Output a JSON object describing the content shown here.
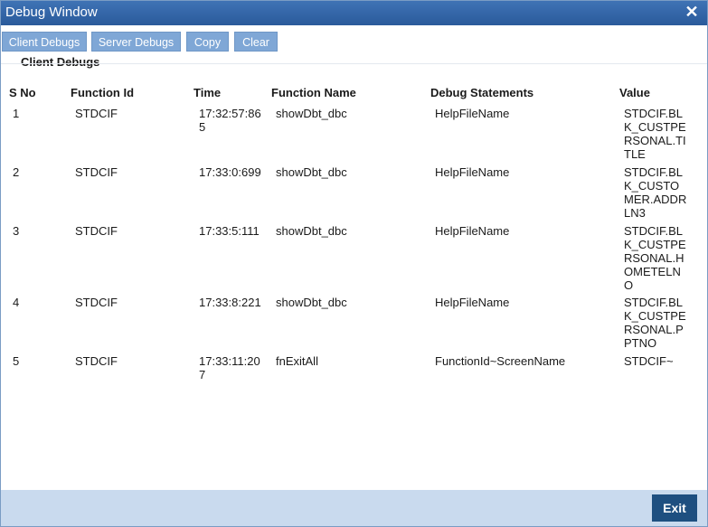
{
  "window": {
    "title": "Debug Window",
    "close_icon": "close-icon"
  },
  "toolbar": {
    "buttons": [
      {
        "label": "Client Debugs"
      },
      {
        "label": "Server Debugs"
      },
      {
        "label": "Copy"
      },
      {
        "label": "Clear"
      }
    ]
  },
  "section": {
    "title": "Client Debugs"
  },
  "table": {
    "headers": [
      "S No",
      "Function Id",
      "Time",
      "Function Name",
      "Debug Statements",
      "Value"
    ],
    "rows": [
      {
        "sno": "1",
        "function_id": "STDCIF",
        "time": "17:32:57:865",
        "function_name": "showDbt_dbc",
        "debug": "HelpFileName",
        "value": "STDCIF.BLK_CUSTPERSONAL.TITLE"
      },
      {
        "sno": "2",
        "function_id": "STDCIF",
        "time": "17:33:0:699",
        "function_name": "showDbt_dbc",
        "debug": "HelpFileName",
        "value": "STDCIF.BLK_CUSTOMER.ADDRLN3"
      },
      {
        "sno": "3",
        "function_id": "STDCIF",
        "time": "17:33:5:111",
        "function_name": "showDbt_dbc",
        "debug": "HelpFileName",
        "value": "STDCIF.BLK_CUSTPERSONAL.HOMETELNO"
      },
      {
        "sno": "4",
        "function_id": "STDCIF",
        "time": "17:33:8:221",
        "function_name": "showDbt_dbc",
        "debug": "HelpFileName",
        "value": "STDCIF.BLK_CUSTPERSONAL.PPTNO"
      },
      {
        "sno": "5",
        "function_id": "STDCIF",
        "time": "17:33:11:207",
        "function_name": "fnExitAll",
        "debug": "FunctionId~ScreenName",
        "value": "STDCIF~"
      }
    ]
  },
  "footer": {
    "exit_label": "Exit"
  }
}
